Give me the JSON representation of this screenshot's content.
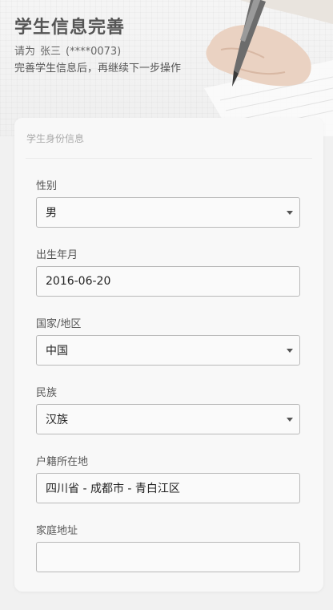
{
  "header": {
    "title": "学生信息完善",
    "greeting_prefix": "请为",
    "student_name": "张三",
    "student_id_masked": "(****0073)",
    "tip": "完善学生信息后，再继续下一步操作"
  },
  "section": {
    "title": "学生身份信息"
  },
  "fields": {
    "gender": {
      "label": "性别",
      "value": "男"
    },
    "birth": {
      "label": "出生年月",
      "value": "2016-06-20"
    },
    "country": {
      "label": "国家/地区",
      "value": "中国"
    },
    "ethnicity": {
      "label": "民族",
      "value": "汉族"
    },
    "hukou": {
      "label": "户籍所在地",
      "value": "四川省 - 成都市 - 青白江区"
    },
    "address": {
      "label": "家庭地址",
      "value": ""
    }
  },
  "colors": {
    "page_bg": "#f1f1f1",
    "card_bg": "#f8f8f8",
    "border": "#b9b9b9",
    "title": "#555555"
  },
  "icons": {
    "hero": "hand-writing-with-pen-photo",
    "caret": "caret-down-icon"
  }
}
